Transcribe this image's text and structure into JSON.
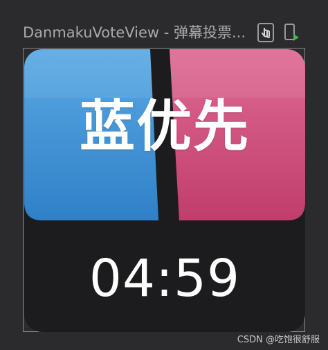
{
  "panel": {
    "title": "DanmakuVoteView - 弹幕投票...",
    "icons": [
      "touch-select-icon",
      "device-run-icon"
    ]
  },
  "vote_view": {
    "label": "蓝优先",
    "timer": "04:59",
    "colors": {
      "blue": "#3a8fd3",
      "pink": "#c74474",
      "background": "#1c1c1e",
      "text": "#ffffff"
    }
  },
  "watermark": "CSDN @吃饱很舒服"
}
